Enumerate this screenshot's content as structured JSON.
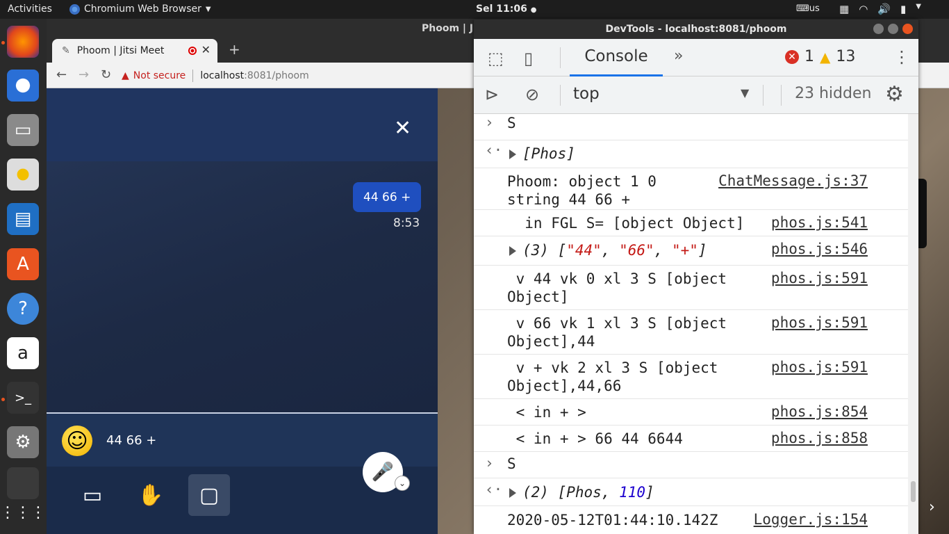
{
  "topbar": {
    "activities": "Activities",
    "app_name": "Chromium Web Browser",
    "clock": "Sel 11:06",
    "keyboard_layout": "us"
  },
  "dock": {
    "items": [
      "firefox-icon",
      "thunderbird-icon",
      "files-icon",
      "rhythmbox-icon",
      "writer-icon",
      "software-icon",
      "help-icon",
      "amazon-icon",
      "terminal-icon",
      "settings-icon",
      "chromium-icon",
      "app-grid-icon"
    ]
  },
  "browser": {
    "window_title": "Phoom | Ji",
    "tab_title": "Phoom | Jitsi Meet",
    "not_secure": "Not secure",
    "url_host": "localhost",
    "url_path": ":8081/phoom"
  },
  "chat": {
    "message": "44 66 +",
    "message_time": "8:53",
    "input_value": "44 66 +"
  },
  "devtools": {
    "title": "DevTools - localhost:8081/phoom",
    "console_tab": "Console",
    "error_count": "1",
    "warning_count": "13",
    "context": "top",
    "hidden_count": "23 hidden"
  },
  "console": {
    "rows": [
      {
        "glyph": ">",
        "text": "S",
        "src": ""
      },
      {
        "glyph": "<·",
        "text": "[Phos]",
        "src": ""
      },
      {
        "glyph": "",
        "text": "Phoom: object 1 0\nstring 44 66 +",
        "src": "ChatMessage.js:37"
      },
      {
        "glyph": "",
        "text": "  in FGL S= [object Object]",
        "src": "phos.js:541"
      },
      {
        "glyph": "",
        "text": "(3) [\"44\", \"66\", \"+\"]",
        "src": "phos.js:546"
      },
      {
        "glyph": "",
        "text": " v 44 vk 0 xl 3 S [object\nObject]",
        "src": "phos.js:591"
      },
      {
        "glyph": "",
        "text": " v 66 vk 1 xl 3 S [object\nObject],44",
        "src": "phos.js:591"
      },
      {
        "glyph": "",
        "text": " v + vk 2 xl 3 S [object\nObject],44,66",
        "src": "phos.js:591"
      },
      {
        "glyph": "",
        "text": " < in + >",
        "src": "phos.js:854"
      },
      {
        "glyph": "",
        "text": " < in + > 66 44 6644",
        "src": "phos.js:858"
      },
      {
        "glyph": ">",
        "text": "S",
        "src": ""
      },
      {
        "glyph": "<·",
        "text": "(2) [Phos, 110]",
        "src": ""
      },
      {
        "glyph": "",
        "text": "2020-05-12T01:44:10.142Z",
        "src": "Logger.js:154"
      }
    ]
  }
}
